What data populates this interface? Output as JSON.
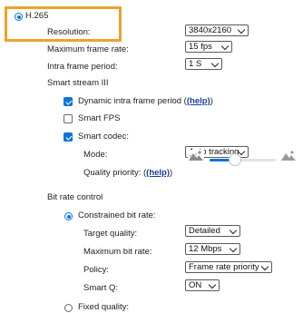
{
  "codec": {
    "label": "H.265",
    "selected": true
  },
  "resolution": {
    "label": "Resolution:",
    "value": "3840x2160"
  },
  "max_frame_rate": {
    "label": "Maximum frame rate:",
    "value": "15 fps"
  },
  "intra_frame_period": {
    "label": "Intra frame period:",
    "value": "1 S"
  },
  "smart_stream": {
    "title": "Smart stream III",
    "dynamic_intra": {
      "label": "Dynamic intra frame period (",
      "help": "(help)",
      "label_end": ")",
      "checked": true
    },
    "smart_fps": {
      "label": "Smart FPS",
      "checked": false
    },
    "smart_codec": {
      "label": "Smart codec:",
      "checked": true
    },
    "mode": {
      "label": "Mode:",
      "value": "Auto tracking"
    },
    "quality_priority": {
      "label": "Quality priority: (",
      "help": "(help)",
      "label_end": ")",
      "level": 0.38
    }
  },
  "bit_rate": {
    "title": "Bit rate control",
    "constrained": {
      "label": "Constrained bit rate:",
      "selected": true
    },
    "target_quality": {
      "label": "Target quality:",
      "value": "Detailed"
    },
    "max_bit_rate": {
      "label": "Maximum bit rate:",
      "value": "12 Mbps"
    },
    "policy": {
      "label": "Policy:",
      "value": "Frame rate priority"
    },
    "smart_q": {
      "label": "Smart Q:",
      "value": "ON"
    },
    "fixed": {
      "label": "Fixed quality:",
      "selected": false
    }
  },
  "colors": {
    "accent": "#0a74d9",
    "highlight": "#f0a12a"
  }
}
